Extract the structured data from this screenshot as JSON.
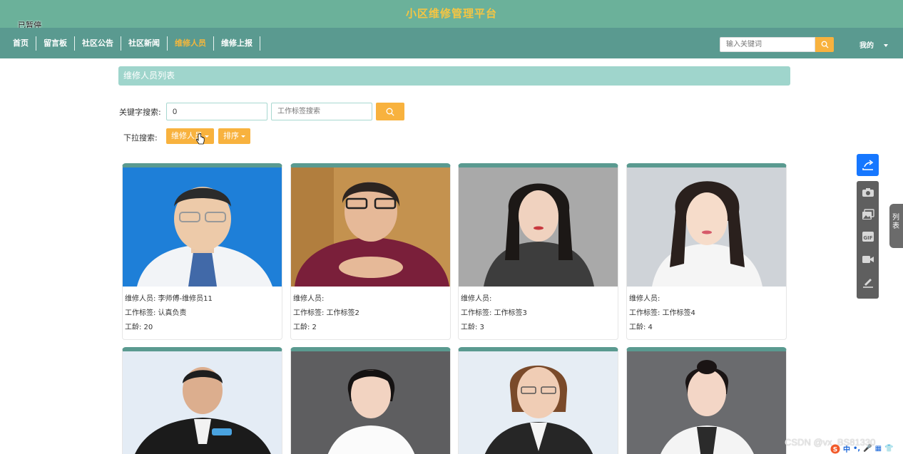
{
  "header": {
    "site_title": "小区维修管理平台",
    "paused_label": "已暂停"
  },
  "nav": {
    "items": [
      "首页",
      "留言板",
      "社区公告",
      "社区新闻",
      "维修人员",
      "维修上报"
    ],
    "active_index": 4,
    "search_placeholder": "输入关键词",
    "mine_label": "我的"
  },
  "list": {
    "header": "维修人员列表",
    "keyword_label": "关键字搜索:",
    "keyword_value": "0",
    "tag_placeholder": "工作标签搜索",
    "dropdown_label": "下拉搜索:",
    "dropdown_staff": "维修人员",
    "dropdown_sort": "排序"
  },
  "cards": [
    {
      "staff": "维修人员: 李师傅-维修员11",
      "tag": "工作标签: 认真负责",
      "years": "工龄: 20"
    },
    {
      "staff": "维修人员:",
      "tag": "工作标签: 工作标签2",
      "years": "工龄: 2"
    },
    {
      "staff": "维修人员:",
      "tag": "工作标签: 工作标签3",
      "years": "工龄: 3"
    },
    {
      "staff": "维修人员:",
      "tag": "工作标签: 工作标签4",
      "years": "工龄: 4"
    }
  ],
  "side": {
    "tab_label": "列表"
  },
  "watermark": "CSDN @vx_BS81330",
  "ime": [
    "中",
    "•,",
    "🎤",
    "▦",
    "👕"
  ],
  "colors": {
    "topbar": "#6bb19a",
    "navbar": "#5a9a90",
    "accent": "#f8b23e",
    "title_text": "#f5c542",
    "header_bar": "#9fd5cc"
  }
}
